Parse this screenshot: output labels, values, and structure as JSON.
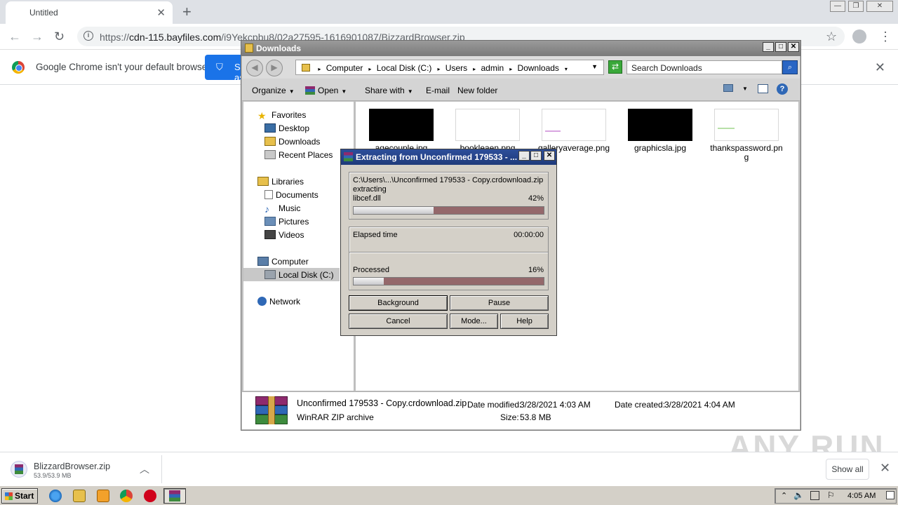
{
  "browser": {
    "tab_title": "Untitled",
    "tab_close": "✕",
    "new_tab": "+",
    "url_prefix": "https://",
    "url_host": "cdn-115.bayfiles.com",
    "url_path": "/i9Yekcpbu8/02a27595-1616901087/BizzardBrowser.zip",
    "infobar_text": "Google Chrome isn't your default browser",
    "infobar_button": "Set as default",
    "infobar_close": "✕"
  },
  "explorer": {
    "title": "Downloads",
    "breadcrumb": [
      "Computer",
      "Local Disk (C:)",
      "Users",
      "admin",
      "Downloads"
    ],
    "search_placeholder": "Search Downloads",
    "commands": {
      "organize": "Organize",
      "open": "Open",
      "share": "Share with",
      "email": "E-mail",
      "new_folder": "New folder"
    },
    "nav": {
      "favorites": "Favorites",
      "desktop": "Desktop",
      "downloads": "Downloads",
      "recent": "Recent Places",
      "libraries": "Libraries",
      "documents": "Documents",
      "music": "Music",
      "pictures": "Pictures",
      "videos": "Videos",
      "computer": "Computer",
      "local_disk": "Local Disk (C:)",
      "network": "Network"
    },
    "files": [
      "agecouple.jpg",
      "bookleaen.png",
      "galleryaverage.png",
      "graphicsla.jpg",
      "thankspassword.png"
    ],
    "details": {
      "name": "Unconfirmed 179533 - Copy.crdownload.zip",
      "type": "WinRAR ZIP archive",
      "modified_label": "Date modified:",
      "modified": "3/28/2021 4:03 AM",
      "created_label": "Date created:",
      "created": "3/28/2021 4:04 AM",
      "size_label": "Size:",
      "size": "53.8 MB"
    }
  },
  "winrar": {
    "title": "Extracting from Unconfirmed 179533 - ...",
    "path": "C:\\Users\\...\\Unconfirmed 179533 - Copy.crdownload.zip",
    "action": "extracting",
    "file": "libcef.dll",
    "file_percent_label": "42%",
    "file_progress": 0.42,
    "elapsed_label": "Elapsed time",
    "elapsed": "00:00:00",
    "processed_label": "Processed",
    "processed_percent_label": "16%",
    "processed_progress": 0.16,
    "buttons": {
      "background": "Background",
      "pause": "Pause",
      "cancel": "Cancel",
      "mode": "Mode...",
      "help": "Help"
    }
  },
  "shelf": {
    "file_name": "BlizzardBrowser.zip",
    "file_size": "53.9/53.9 MB",
    "show_all": "Show all",
    "watermark": "ANY RUN"
  },
  "taskbar": {
    "start": "Start",
    "clock": "4:05 AM"
  },
  "colors": {
    "dialog_title": "#1e3a7b",
    "progress_track": "#94686b",
    "chrome_blue": "#1a73e8"
  }
}
